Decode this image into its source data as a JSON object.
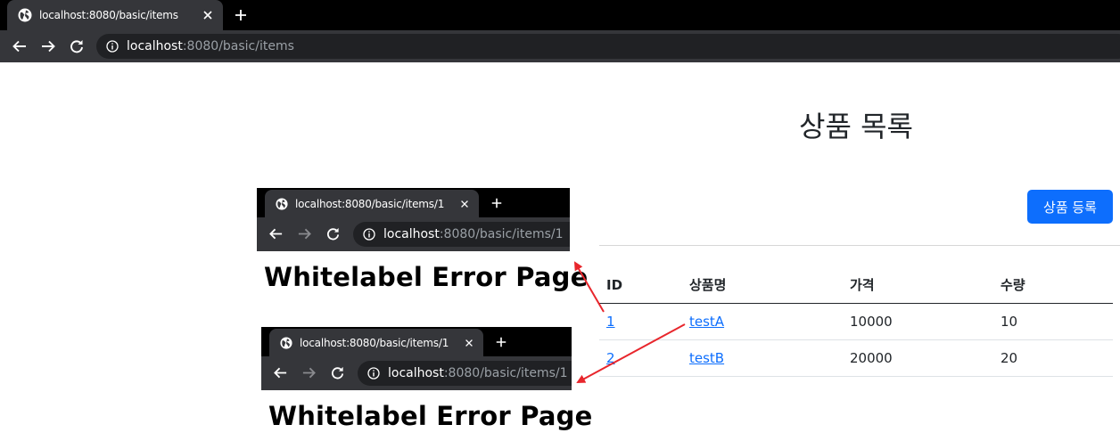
{
  "browser": {
    "tab_title": "localhost:8080/basic/items",
    "url_host": "localhost",
    "url_rest": ":8080/basic/items"
  },
  "page": {
    "title": "상품 목록",
    "add_button": "상품 등록",
    "table": {
      "headers": [
        "ID",
        "상품명",
        "가격",
        "수량"
      ],
      "rows": [
        {
          "id": "1",
          "name": "testA",
          "price": "10000",
          "quantity": "10"
        },
        {
          "id": "2",
          "name": "testB",
          "price": "20000",
          "quantity": "20"
        }
      ]
    },
    "link_color": "#0d6efd",
    "button_color": "#0d6efd"
  },
  "annotations": {
    "mini_browsers": [
      {
        "tab_title": "localhost:8080/basic/items/1",
        "url_host": "localhost",
        "url_rest": ":8080/basic/items/1",
        "page_text": "Whitelabel Error Page"
      },
      {
        "tab_title": "localhost:8080/basic/items/1",
        "url_host": "localhost",
        "url_rest": ":8080/basic/items/1",
        "page_text": "Whitelabel Error Page"
      }
    ],
    "arrow_color": "#e8262c"
  }
}
